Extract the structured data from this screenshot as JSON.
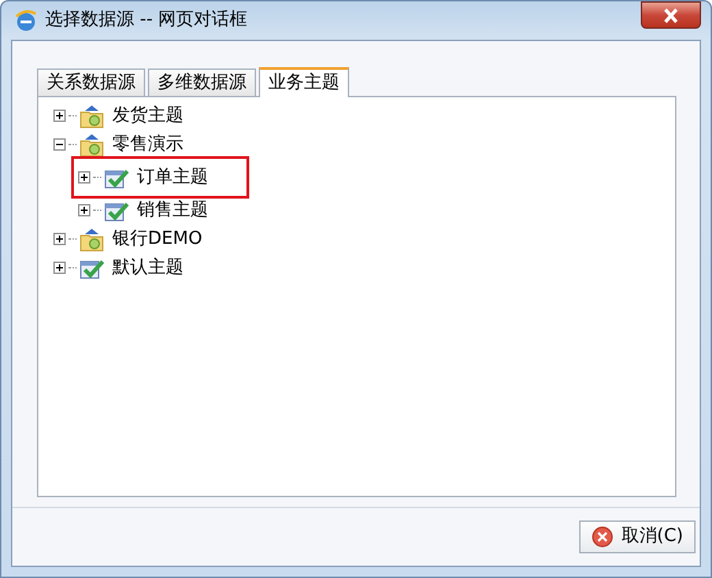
{
  "window": {
    "title": "选择数据源 -- 网页对话框"
  },
  "tabs": [
    {
      "label": "关系数据源",
      "selected": false
    },
    {
      "label": "多维数据源",
      "selected": false
    },
    {
      "label": "业务主题",
      "selected": true
    }
  ],
  "tree": [
    {
      "label": "发货主题",
      "kind": "folder",
      "expanded": false,
      "highlighted": false
    },
    {
      "label": "零售演示",
      "kind": "folder",
      "expanded": true,
      "highlighted": false,
      "children": [
        {
          "label": "订单主题",
          "kind": "theme",
          "expanded": false,
          "highlighted": true
        },
        {
          "label": "销售主题",
          "kind": "theme",
          "expanded": false,
          "highlighted": false
        }
      ]
    },
    {
      "label": "银行DEMO",
      "kind": "folder",
      "expanded": false,
      "highlighted": false
    },
    {
      "label": "默认主题",
      "kind": "theme",
      "expanded": false,
      "highlighted": false
    }
  ],
  "buttons": [
    {
      "label": "取消(C)"
    }
  ]
}
